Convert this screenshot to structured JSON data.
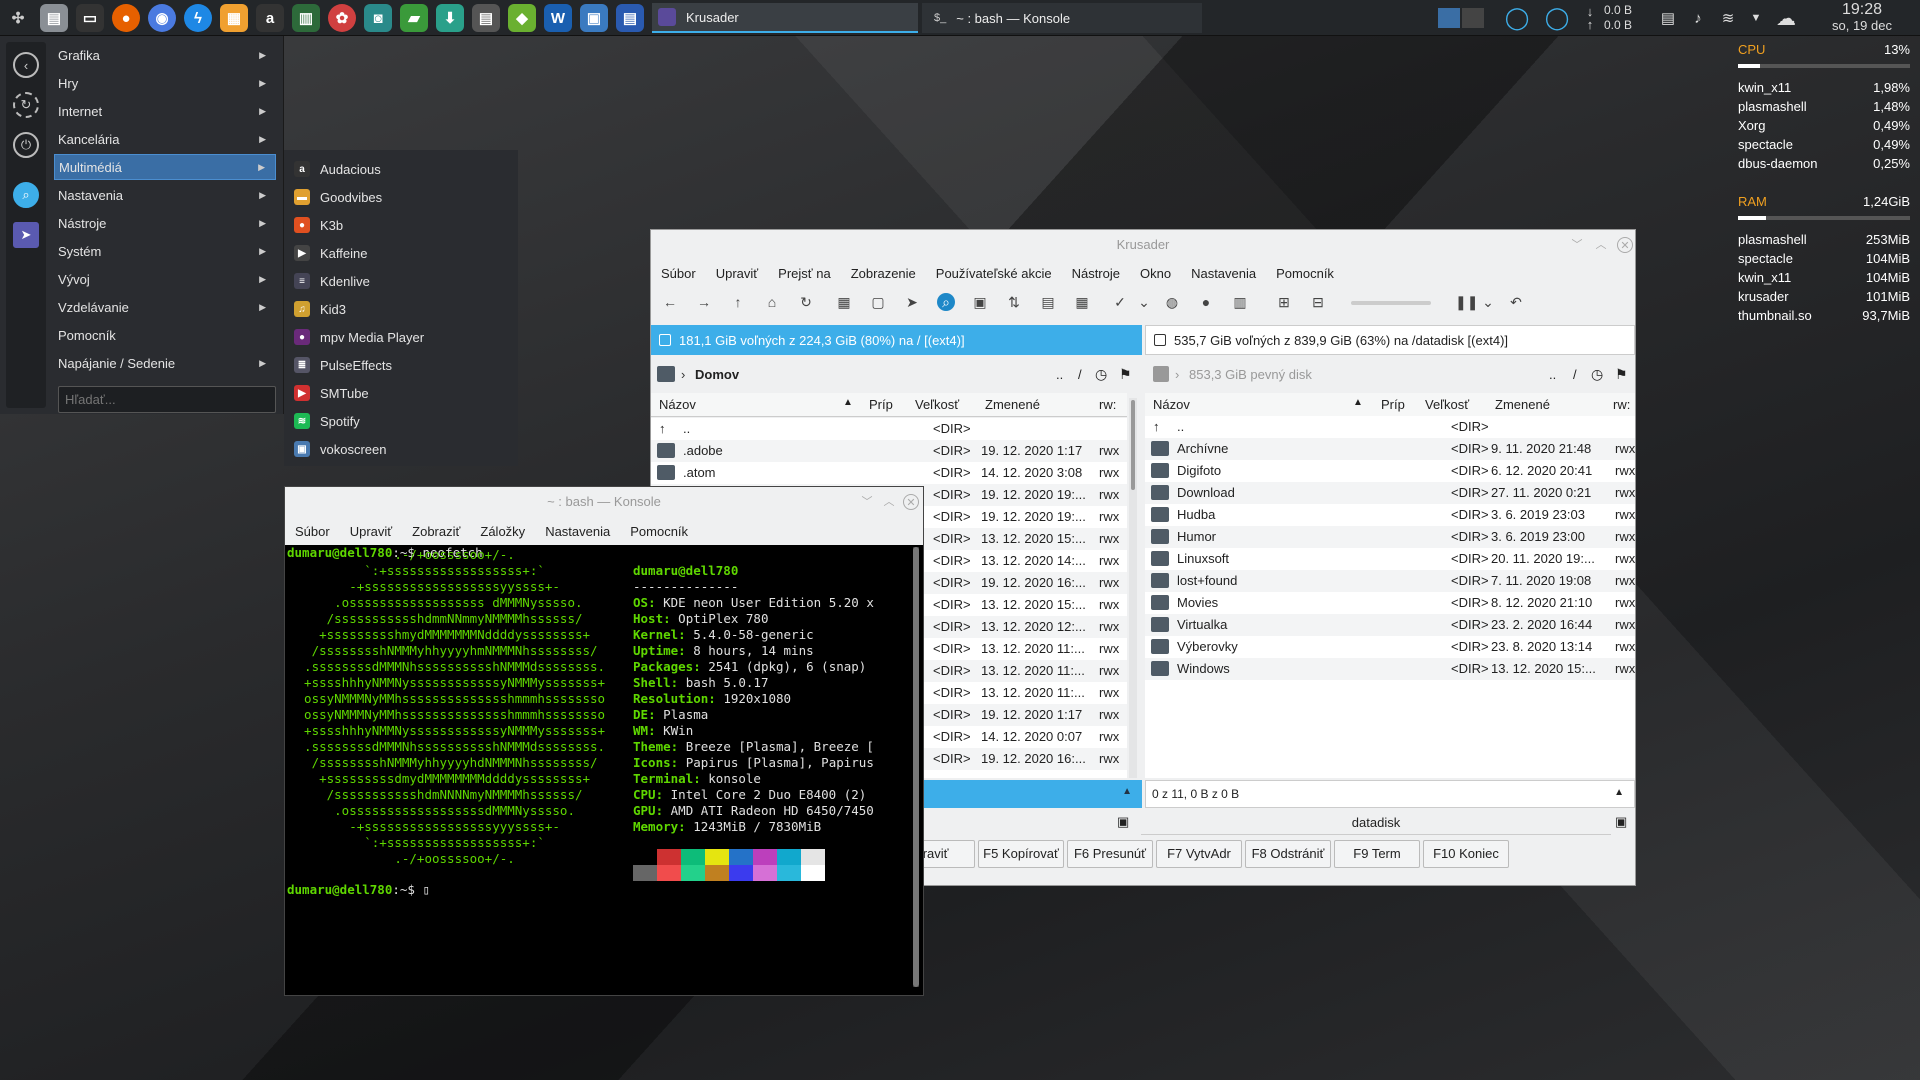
{
  "taskbar": {
    "tasks": [
      {
        "label": "Krusader"
      },
      {
        "label": "~ : bash — Konsole"
      }
    ],
    "net": {
      "down": "0.0 B",
      "up": "0.0 B"
    },
    "clock": {
      "time": "19:28",
      "date": "so, 19 dec"
    }
  },
  "menu": {
    "items": [
      {
        "label": "Grafika",
        "sub": true
      },
      {
        "label": "Hry",
        "sub": true
      },
      {
        "label": "Internet",
        "sub": true
      },
      {
        "label": "Kancelária",
        "sub": true
      },
      {
        "label": "Multimédiá",
        "sub": true,
        "selected": true
      },
      {
        "label": "Nastavenia",
        "sub": true
      },
      {
        "label": "Nástroje",
        "sub": true
      },
      {
        "label": "Systém",
        "sub": true
      },
      {
        "label": "Vývoj",
        "sub": true
      },
      {
        "label": "Vzdelávanie",
        "sub": true
      },
      {
        "label": "Pomocník",
        "sub": false
      },
      {
        "label": "Napájanie / Sedenie",
        "sub": true
      }
    ],
    "search_placeholder": "Hľadať...",
    "submenu": [
      {
        "label": "Audacious",
        "color": "#333",
        "glyph": "a"
      },
      {
        "label": "Goodvibes",
        "color": "#e0a030",
        "glyph": "▬"
      },
      {
        "label": "K3b",
        "color": "#e05020",
        "glyph": "●"
      },
      {
        "label": "Kaffeine",
        "color": "#444",
        "glyph": "▶"
      },
      {
        "label": "Kdenlive",
        "color": "#445",
        "glyph": "≡"
      },
      {
        "label": "Kid3",
        "color": "#d0a030",
        "glyph": "♫"
      },
      {
        "label": "mpv Media Player",
        "color": "#6a2a7a",
        "glyph": "●"
      },
      {
        "label": "PulseEffects",
        "color": "#556",
        "glyph": "≣"
      },
      {
        "label": "SMTube",
        "color": "#d03030",
        "glyph": "▶"
      },
      {
        "label": "Spotify",
        "color": "#1db954",
        "glyph": "≋"
      },
      {
        "label": "vokoscreen",
        "color": "#4a7ab0",
        "glyph": "▣"
      }
    ]
  },
  "krusader": {
    "title": "Krusader",
    "menubar": [
      "Súbor",
      "Upraviť",
      "Prejsť na",
      "Zobrazenie",
      "Používateľské akcie",
      "Nástroje",
      "Okno",
      "Nastavenia",
      "Pomocník"
    ],
    "left": {
      "free": "181,1 GiB voľných z 224,3 GiB (80%) na / [(ext4)]",
      "path": "Domov",
      "headers": [
        "Názov",
        "Príp",
        "Veľkosť",
        "Zmenené",
        "rw:"
      ],
      "rows": [
        {
          "name": "..",
          "size": "<DIR>",
          "date": "",
          "rwx": ""
        },
        {
          "name": ".adobe",
          "size": "<DIR>",
          "date": "19. 12. 2020 1:17",
          "rwx": "rwx"
        },
        {
          "name": ".atom",
          "size": "<DIR>",
          "date": "14. 12. 2020 3:08",
          "rwx": "rwx"
        },
        {
          "name": "",
          "size": "<DIR>",
          "date": "19. 12. 2020 19:...",
          "rwx": "rwx"
        },
        {
          "name": "",
          "size": "<DIR>",
          "date": "19. 12. 2020 19:...",
          "rwx": "rwx"
        },
        {
          "name": "",
          "size": "<DIR>",
          "date": "13. 12. 2020 15:...",
          "rwx": "rwx"
        },
        {
          "name": "",
          "size": "<DIR>",
          "date": "13. 12. 2020 14:...",
          "rwx": "rwx"
        },
        {
          "name": "",
          "size": "<DIR>",
          "date": "19. 12. 2020 16:...",
          "rwx": "rwx"
        },
        {
          "name": "",
          "size": "<DIR>",
          "date": "13. 12. 2020 15:...",
          "rwx": "rwx"
        },
        {
          "name": "",
          "size": "<DIR>",
          "date": "13. 12. 2020 12:...",
          "rwx": "rwx"
        },
        {
          "name": "",
          "size": "<DIR>",
          "date": "13. 12. 2020 11:...",
          "rwx": "rwx"
        },
        {
          "name": "",
          "size": "<DIR>",
          "date": "13. 12. 2020 11:...",
          "rwx": "rwx"
        },
        {
          "name": "",
          "size": "<DIR>",
          "date": "13. 12. 2020 11:...",
          "rwx": "rwx"
        },
        {
          "name": "",
          "size": "<DIR>",
          "date": "19. 12. 2020 1:17",
          "rwx": "rwx"
        },
        {
          "name": "",
          "size": "<DIR>",
          "date": "14. 12. 2020 0:07",
          "rwx": "rwx"
        },
        {
          "name": "",
          "size": "<DIR>",
          "date": "19. 12. 2020 16:...",
          "rwx": "rwx"
        }
      ]
    },
    "right": {
      "free": "535,7 GiB voľných z 839,9 GiB (63%) na /datadisk [(ext4)]",
      "path": "853,3 GiB pevný disk",
      "headers": [
        "Názov",
        "Príp",
        "Veľkosť",
        "Zmenené",
        "rw:"
      ],
      "rows": [
        {
          "name": "..",
          "size": "<DIR>",
          "date": "",
          "rwx": ""
        },
        {
          "name": "Archívne",
          "size": "<DIR>",
          "date": "9. 11. 2020 21:48",
          "rwx": "rwx"
        },
        {
          "name": "Digifoto",
          "size": "<DIR>",
          "date": "6. 12. 2020 20:41",
          "rwx": "rwx"
        },
        {
          "name": "Download",
          "size": "<DIR>",
          "date": "27. 11. 2020 0:21",
          "rwx": "rwx"
        },
        {
          "name": "Hudba",
          "size": "<DIR>",
          "date": "3. 6. 2019 23:03",
          "rwx": "rwx"
        },
        {
          "name": "Humor",
          "size": "<DIR>",
          "date": "3. 6. 2019 23:00",
          "rwx": "rwx"
        },
        {
          "name": "Linuxsoft",
          "size": "<DIR>",
          "date": "20. 11. 2020 19:...",
          "rwx": "rwx"
        },
        {
          "name": "lost+found",
          "size": "<DIR>",
          "date": "7. 11. 2020 19:08",
          "rwx": "rwx"
        },
        {
          "name": "Movies",
          "size": "<DIR>",
          "date": "8. 12. 2020 21:10",
          "rwx": "rwx"
        },
        {
          "name": "Virtualka",
          "size": "<DIR>",
          "date": "23. 2. 2020 16:44",
          "rwx": "rwx"
        },
        {
          "name": "Výberovky",
          "size": "<DIR>",
          "date": "23. 8. 2020 13:14",
          "rwx": "rwx"
        },
        {
          "name": "Windows",
          "size": "<DIR>",
          "date": "13. 12. 2020 15:...",
          "rwx": "rwx"
        }
      ],
      "status": "0 z 11, 0 B z 0 B",
      "cmdline": "datadisk"
    },
    "fkeys": [
      "praviť",
      "F5 Kopírovať",
      "F6 Presunúť",
      "F7 VytvAdr",
      "F8 Odstrániť",
      "F9 Term",
      "F10 Koniec"
    ]
  },
  "konsole": {
    "title": "~ : bash — Konsole",
    "menubar": [
      "Súbor",
      "Upraviť",
      "Zobraziť",
      "Záložky",
      "Nastavenia",
      "Pomocník"
    ],
    "prompt_user": "dumaru@dell780",
    "prompt_suffix": ":~$ ",
    "cmd": "neofetch",
    "logo": "              .-/+oossssoo+/-.\n          `:+ssssssssssssssssss+:`\n        -+ssssssssssssssssssyyssss+-\n      .ossssssssssssssssss dMMMNysssso.\n     /ssssssssssshdmmNNmmyNMMMMhssssss/\n    +ssssssssshmydMMMMMMMNddddyssssssss+\n   /sssssssshNMMMyhhyyyyhmNMMMNhssssssss/\n  .ssssssssdMMMNhsssssssssshNMMMdssssssss.\n  +sssshhhyNMMNyssssssssssssyNMMMysssssss+\n  ossyNMMMNyMMhsssssssssssssshmmmhssssssso\n  ossyNMMMNyMMhsssssssssssssshmmmhssssssso\n  +sssshhhyNMMNyssssssssssssyNMMMysssssss+\n  .ssssssssdMMMNhsssssssssshNMMMdssssssss.\n   /sssssssshNMMMyhhyyyyhdNMMMNhssssssss/\n    +sssssssssdmydMMMMMMMMddddyssssssss+\n     /ssssssssssshdmNNNNmyNMMMMhssssss/\n      .ossssssssssssssssssdMMMNysssso.\n        -+sssssssssssssssssyyyssss+-\n          `:+ssssssssssssssssss+:`\n              .-/+oossssoo+/-.",
    "info": {
      "header": "dumaru@dell780",
      "sep": "--------------",
      "lines": [
        [
          "OS",
          "KDE neon User Edition 5.20 x"
        ],
        [
          "Host",
          "OptiPlex 780"
        ],
        [
          "Kernel",
          "5.4.0-58-generic"
        ],
        [
          "Uptime",
          "8 hours, 14 mins"
        ],
        [
          "Packages",
          "2541 (dpkg), 6 (snap)"
        ],
        [
          "Shell",
          "bash 5.0.17"
        ],
        [
          "Resolution",
          "1920x1080"
        ],
        [
          "DE",
          "Plasma"
        ],
        [
          "WM",
          "KWin"
        ],
        [
          "Theme",
          "Breeze [Plasma], Breeze ["
        ],
        [
          "Icons",
          "Papirus [Plasma], Papirus"
        ],
        [
          "Terminal",
          "konsole"
        ],
        [
          "CPU",
          "Intel Core 2 Duo E8400 (2)"
        ],
        [
          "GPU",
          "AMD ATI Radeon HD 6450/7450"
        ],
        [
          "Memory",
          "1243MiB / 7830MiB"
        ]
      ]
    },
    "swatches_top": [
      "#000000",
      "#cd3131",
      "#0dbc79",
      "#e5e510",
      "#2472c8",
      "#bc3fbc",
      "#11a8cd",
      "#e5e5e5"
    ],
    "swatches_bottom": [
      "#666666",
      "#f14c4c",
      "#23d18b",
      "#c08020",
      "#3b3bee",
      "#d670d6",
      "#29b8db",
      "#ffffff"
    ]
  },
  "sysmon": {
    "cpu": {
      "label": "CPU",
      "value": "13%",
      "level": 0.13,
      "procs": [
        [
          "kwin_x11",
          "1,98%"
        ],
        [
          "plasmashell",
          "1,48%"
        ],
        [
          "Xorg",
          "0,49%"
        ],
        [
          "spectacle",
          "0,49%"
        ],
        [
          "dbus-daemon",
          "0,25%"
        ]
      ]
    },
    "ram": {
      "label": "RAM",
      "value": "1,24GiB",
      "level": 0.16,
      "procs": [
        [
          "plasmashell",
          "253MiB"
        ],
        [
          "spectacle",
          "104MiB"
        ],
        [
          "kwin_x11",
          "104MiB"
        ],
        [
          "krusader",
          "101MiB"
        ],
        [
          "thumbnail.so",
          "93,7MiB"
        ]
      ]
    }
  },
  "colors": {
    "accent": "#3daee9",
    "selection": "#3a6ea5",
    "cpu_label": "#f0a020",
    "terminal_green": "#5fd700"
  }
}
